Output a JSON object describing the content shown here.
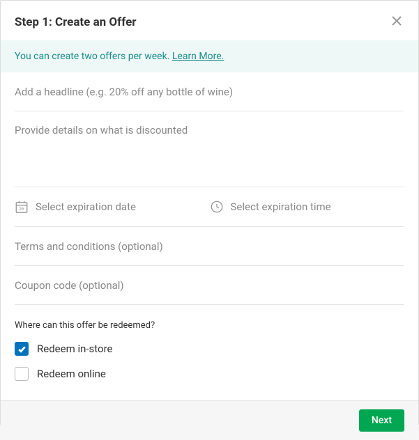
{
  "header": {
    "title": "Step 1: Create an Offer"
  },
  "banner": {
    "text": "You can create two offers per week. ",
    "link": "Learn More."
  },
  "fields": {
    "headline_placeholder": "Add a headline (e.g. 20% off any bottle of wine)",
    "details_placeholder": "Provide details on what is discounted",
    "date_placeholder": "Select expiration date",
    "time_placeholder": "Select expiration time",
    "terms_placeholder": "Terms and conditions (optional)",
    "coupon_placeholder": "Coupon code (optional)"
  },
  "redeem": {
    "title": "Where can this offer be redeemed?",
    "in_store_label": "Redeem in-store",
    "in_store_checked": true,
    "online_label": "Redeem online",
    "online_checked": false
  },
  "footer": {
    "next_label": "Next"
  }
}
